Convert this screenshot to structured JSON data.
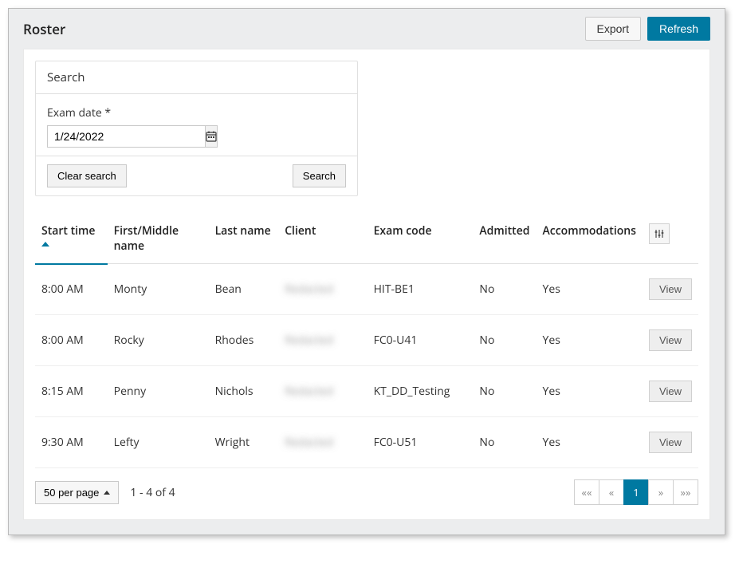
{
  "header": {
    "title": "Roster",
    "export_label": "Export",
    "refresh_label": "Refresh"
  },
  "search": {
    "panel_title": "Search",
    "date_label": "Exam date *",
    "date_value": "1/24/2022",
    "clear_label": "Clear search",
    "search_label": "Search"
  },
  "table": {
    "columns": {
      "start_time": "Start time",
      "first_middle": "First/Middle name",
      "last_name": "Last name",
      "client": "Client",
      "exam_code": "Exam code",
      "admitted": "Admitted",
      "accommodations": "Accommodations"
    },
    "view_label": "View",
    "rows": [
      {
        "start_time": "8:00 AM",
        "first_middle": "Monty",
        "last_name": "Bean",
        "client": "Redacted",
        "exam_code": "HIT-BE1",
        "admitted": "No",
        "accommodations": "Yes"
      },
      {
        "start_time": "8:00 AM",
        "first_middle": "Rocky",
        "last_name": "Rhodes",
        "client": "Redacted",
        "exam_code": "FC0-U41",
        "admitted": "No",
        "accommodations": "Yes"
      },
      {
        "start_time": "8:15 AM",
        "first_middle": "Penny",
        "last_name": "Nichols",
        "client": "Redacted",
        "exam_code": "KT_DD_Testing",
        "admitted": "No",
        "accommodations": "Yes"
      },
      {
        "start_time": "9:30 AM",
        "first_middle": "Lefty",
        "last_name": "Wright",
        "client": "Redacted",
        "exam_code": "FC0-U51",
        "admitted": "No",
        "accommodations": "Yes"
      }
    ]
  },
  "footer": {
    "page_size_label": "50 per page",
    "range_text": "1 - 4 of 4",
    "pagination": {
      "first": "««",
      "prev": "«",
      "current": "1",
      "next": "»",
      "last": "»»"
    }
  }
}
